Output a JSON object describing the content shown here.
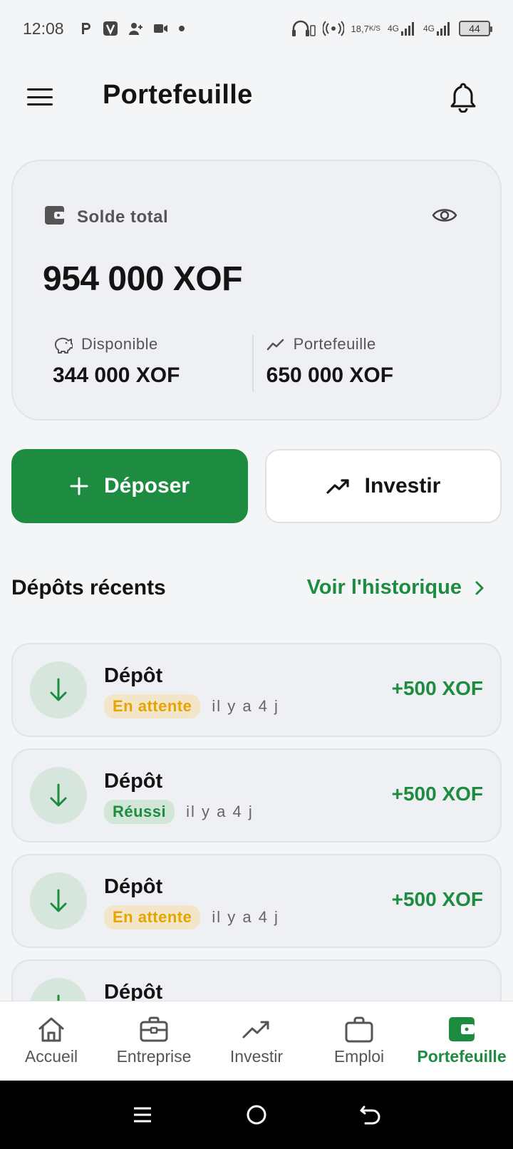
{
  "status_bar": {
    "time": "12:08",
    "net_speed_top": "18,7",
    "net_speed_bottom": "K/S",
    "signal_1": "4G",
    "signal_2": "4G",
    "battery": "44"
  },
  "header": {
    "title": "Portefeuille"
  },
  "balance": {
    "label": "Solde total",
    "total": "954 000 XOF",
    "available_label": "Disponible",
    "available_value": "344 000 XOF",
    "portfolio_label": "Portefeuille",
    "portfolio_value": "650 000 XOF"
  },
  "actions": {
    "deposit_label": "Déposer",
    "invest_label": "Investir"
  },
  "recent": {
    "title": "Dépôts récents",
    "history_link": "Voir l'historique",
    "items": [
      {
        "title": "Dépôt",
        "status": "En attente",
        "time": "il y a 4 j",
        "amount": "+500 XOF"
      },
      {
        "title": "Dépôt",
        "status": "Réussi",
        "time": "il y a 4 j",
        "amount": "+500 XOF"
      },
      {
        "title": "Dépôt",
        "status": "En attente",
        "time": "il y a 4 j",
        "amount": "+500 XOF"
      },
      {
        "title": "Dépôt",
        "status": "",
        "time": "",
        "amount": ""
      }
    ]
  },
  "bottom_nav": {
    "items": [
      {
        "label": "Accueil",
        "icon": "home-icon"
      },
      {
        "label": "Entreprise",
        "icon": "briefcase-icon"
      },
      {
        "label": "Investir",
        "icon": "trending-up-icon"
      },
      {
        "label": "Emploi",
        "icon": "bag-icon"
      },
      {
        "label": "Portefeuille",
        "icon": "wallet-icon"
      }
    ],
    "active": "Portefeuille"
  },
  "colors": {
    "accent": "#1e8c40",
    "pending": "#e6a400",
    "background": "#f4f5f7"
  }
}
